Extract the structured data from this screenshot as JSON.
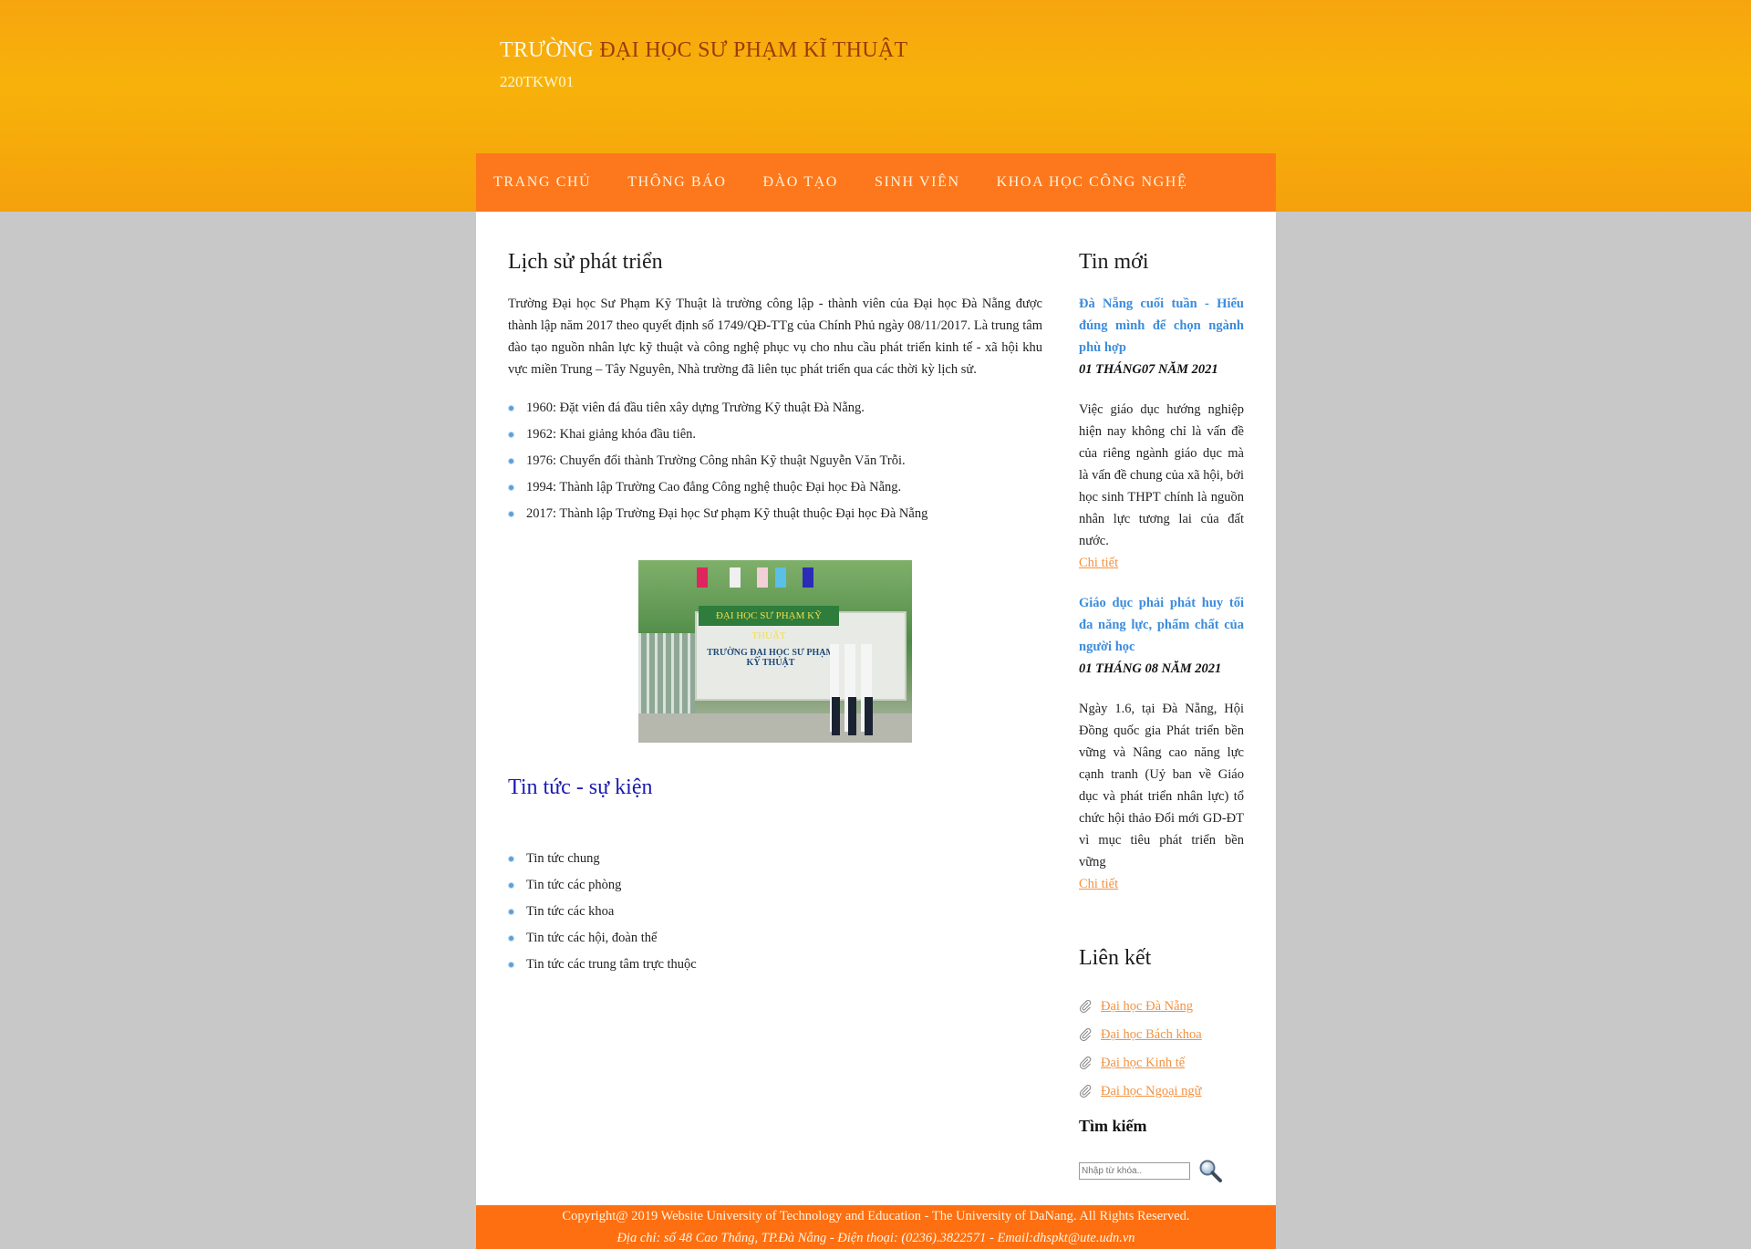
{
  "header": {
    "title_part1": "TRƯỜNG",
    "title_part2": "ĐẠI HỌC SƯ PHẠM KĨ THUẬT",
    "subtitle": "220TKW01"
  },
  "nav": {
    "items": [
      {
        "label": "TRANG CHỦ"
      },
      {
        "label": "THÔNG BÁO"
      },
      {
        "label": "ĐÀO TẠO"
      },
      {
        "label": "SINH VIÊN"
      },
      {
        "label": "KHOA HỌC CÔNG NGHỆ"
      }
    ]
  },
  "main": {
    "history_title": "Lịch sử phát triển",
    "intro": "Trường Đại học Sư Phạm Kỹ Thuật là trường công lập - thành viên của Đại học Đà Nẵng được thành lập năm 2017 theo quyết định số 1749/QĐ-TTg của Chính Phủ ngày 08/11/2017. Là trung tâm đào tạo nguồn nhân lực kỹ thuật và công nghệ phục vụ cho nhu cầu phát triển kinh tế - xã hội khu vực miền Trung – Tây Nguyên, Nhà trường đã liên tục phát triển qua các thời kỳ lịch sử.",
    "milestones": [
      "1960: Đặt viên đá đầu tiên xây dựng Trường Kỹ thuật Đà Nẵng.",
      "1962: Khai giảng khóa đầu tiên.",
      "1976: Chuyển đổi thành Trường Công nhân Kỹ thuật Nguyễn Văn Trỗi.",
      "1994: Thành lập Trường Cao đẳng Công nghệ thuộc Đại học Đà Nẵng.",
      "2017: Thành lập Trường Đại học Sư phạm Kỹ thuật thuộc Đại học Đà Nẵng"
    ],
    "photo": {
      "sign_top": "ĐẠI HỌC SƯ PHẠM KỸ THUẬT",
      "sign_text": "TRƯỜNG ĐẠI HỌC SƯ PHẠM KỸ THUẬT"
    },
    "news_title": "Tin tức - sự kiện",
    "news_items": [
      "Tin tức chung",
      "Tin tức các phòng",
      "Tin tức các khoa",
      "Tin tức các hội, đoàn thể",
      "Tin tức các trung tâm trực thuộc"
    ]
  },
  "sidebar": {
    "latest_title": "Tin mới",
    "posts": [
      {
        "title": "Đà Nẵng cuối tuần - Hiểu đúng mình để chọn ngành phù hợp",
        "date": "01 THÁNG07 NĂM 2021",
        "body": "Việc giáo dục hướng nghiệp hiện nay không chỉ là vấn đề của riêng ngành giáo dục mà là vấn đề chung của xã hội, bởi học sinh THPT chính là nguồn nhân lực tương lai của đất nước.",
        "more": "Chi tiết"
      },
      {
        "title": "Giáo dục phải phát huy tối đa năng lực, phẩm chất của người học",
        "date": "01 THÁNG 08 NĂM 2021",
        "body": "Ngày 1.6, tại Đà Nẵng, Hội Đồng quốc gia Phát triển bền vững và Nâng cao năng lực cạnh tranh (Uỷ ban về Giáo dục và phát triển nhân lực) tổ chức hội thảo Đổi mới GD-ĐT vì mục tiêu phát triển bền vững",
        "more": "Chi tiết"
      }
    ],
    "links_title": "Liên kết",
    "links": [
      "Đại học Đà Nẵng",
      "Đại học Bách khoa",
      "Đại học Kinh tế",
      "Đại học Ngoại ngữ"
    ],
    "search_title": "Tìm kiếm",
    "search_placeholder": "Nhập từ khóa.."
  },
  "footer": {
    "line1": "Copyright@ 2019 Website University of Technology and Education - The University of DaNang. All Rights Reserved.",
    "line2": "Địa chỉ: số 48 Cao Thắng, TP.Đà Nẵng - Điện thoại: (0236).3822571 - Email:dhspkt@ute.udn.vn"
  },
  "colors": {
    "header_bg": "#f7a50f",
    "nav_bg": "#fd781c",
    "link": "#f39240",
    "post_title": "#3c8cdc",
    "news_heading": "#1a1ab0",
    "footer_bg": "#fd6f10"
  },
  "icons": {
    "search": "magnifier-icon",
    "link": "paperclip-icon"
  }
}
